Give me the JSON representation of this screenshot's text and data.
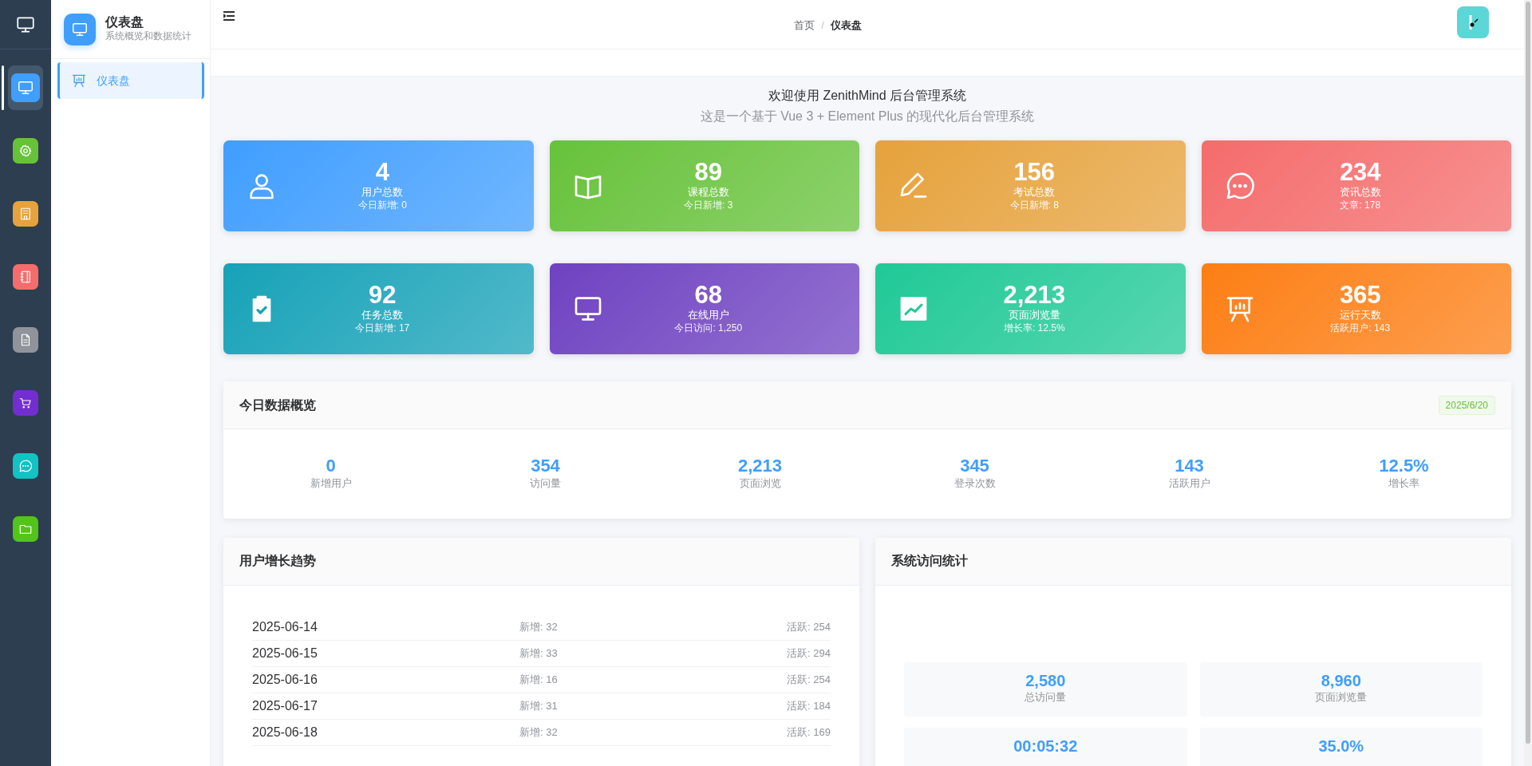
{
  "rail": [
    {
      "color": "#409eff",
      "selected": true
    },
    {
      "color": "#67c23a",
      "selected": false
    },
    {
      "color": "#e6a23c",
      "selected": false
    },
    {
      "color": "#f56c6c",
      "selected": false
    },
    {
      "color": "#909399",
      "selected": false
    },
    {
      "color": "#722ed1",
      "selected": false
    },
    {
      "color": "#13c2c2",
      "selected": false
    },
    {
      "color": "#52c41a",
      "selected": false
    }
  ],
  "sidebar": {
    "title": "仪表盘",
    "subtitle": "系统概览和数据统计",
    "items": [
      {
        "label": "仪表盘",
        "selected": true
      }
    ]
  },
  "breadcrumb": [
    {
      "label": "首页",
      "current": false
    },
    {
      "label": "仪表盘",
      "current": true
    }
  ],
  "breadcrumb_separator": "/",
  "welcome": {
    "title": "欢迎使用 ZenithMind 后台管理系统",
    "subtitle": "这是一个基于 Vue 3 + Element Plus 的现代化后台管理系统"
  },
  "stats": [
    {
      "value": "4",
      "label": "用户总数",
      "sub": "今日新增: 0",
      "color": "#409eff"
    },
    {
      "value": "89",
      "label": "课程总数",
      "sub": "今日新增: 3",
      "color": "#67c23a"
    },
    {
      "value": "156",
      "label": "考试总数",
      "sub": "今日新增: 8",
      "color": "#e6a23c"
    },
    {
      "value": "234",
      "label": "资讯总数",
      "sub": "文章: 178",
      "color": "#f56c6c"
    },
    {
      "value": "92",
      "label": "任务总数",
      "sub": "今日新增: 17",
      "color": "#17a2b8"
    },
    {
      "value": "68",
      "label": "在线用户",
      "sub": "今日访问: 1,250",
      "color": "#6f42c1"
    },
    {
      "value": "2,213",
      "label": "页面浏览量",
      "sub": "增长率: 12.5%",
      "color": "#20c997"
    },
    {
      "value": "365",
      "label": "运行天数",
      "sub": "活跃用户: 143",
      "color": "#fd7e14"
    }
  ],
  "overview": {
    "title": "今日数据概览",
    "date": "2025/6/20",
    "items": [
      {
        "value": "0",
        "label": "新增用户"
      },
      {
        "value": "354",
        "label": "访问量"
      },
      {
        "value": "2,213",
        "label": "页面浏览"
      },
      {
        "value": "345",
        "label": "登录次数"
      },
      {
        "value": "143",
        "label": "活跃用户"
      },
      {
        "value": "12.5%",
        "label": "增长率"
      }
    ]
  },
  "growth": {
    "title": "用户增长趋势",
    "rows": [
      {
        "date": "2025-06-14",
        "new": "新增: 32",
        "active": "活跃: 254"
      },
      {
        "date": "2025-06-15",
        "new": "新增: 33",
        "active": "活跃: 294"
      },
      {
        "date": "2025-06-16",
        "new": "新增: 16",
        "active": "活跃: 254"
      },
      {
        "date": "2025-06-17",
        "new": "新增: 31",
        "active": "活跃: 184"
      },
      {
        "date": "2025-06-18",
        "new": "新增: 32",
        "active": "活跃: 169"
      }
    ]
  },
  "visits": {
    "title": "系统访问统计",
    "items": [
      {
        "value": "2,580",
        "label": "总访问量"
      },
      {
        "value": "8,960",
        "label": "页面浏览量"
      },
      {
        "value": "00:05:32"
      },
      {
        "value": "35.0%"
      }
    ]
  }
}
